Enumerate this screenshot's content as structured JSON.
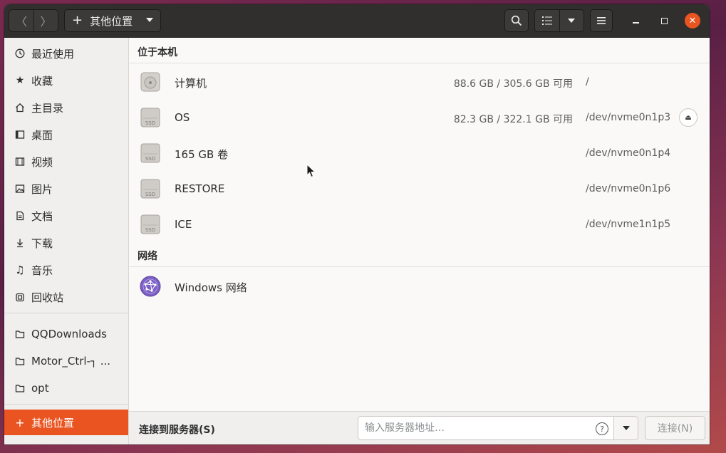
{
  "header": {
    "back_icon": "chevron-left-icon",
    "forward_icon": "chevron-right-icon",
    "location_label": "其他位置",
    "location_icon": "plus-icon"
  },
  "sidebar": {
    "items": [
      {
        "label": "最近使用",
        "icon": "clock-icon"
      },
      {
        "label": "收藏",
        "icon": "star-icon"
      },
      {
        "label": "主目录",
        "icon": "home-icon"
      },
      {
        "label": "桌面",
        "icon": "desktop-icon"
      },
      {
        "label": "视频",
        "icon": "film-icon"
      },
      {
        "label": "图片",
        "icon": "image-icon"
      },
      {
        "label": "文档",
        "icon": "document-icon"
      },
      {
        "label": "下载",
        "icon": "download-icon"
      },
      {
        "label": "音乐",
        "icon": "music-icon"
      },
      {
        "label": "回收站",
        "icon": "trash-icon"
      }
    ],
    "bookmarks": [
      {
        "label": "QQDownloads",
        "icon": "folder-icon"
      },
      {
        "label": "Motor_Ctrl-┐ ...",
        "icon": "folder-icon"
      },
      {
        "label": "opt",
        "icon": "folder-icon"
      }
    ],
    "other_locations": {
      "label": "其他位置",
      "icon": "plus-icon",
      "active_color": "#e95420"
    }
  },
  "main": {
    "local_section": "位于本机",
    "drives": [
      {
        "name": "计算机",
        "space": "88.6 GB / 305.6 GB 可用",
        "device": "/",
        "icon": "harddisk-icon"
      },
      {
        "name": "OS",
        "space": "82.3 GB / 322.1 GB 可用",
        "device": "/dev/nvme0n1p3",
        "icon": "ssd-icon",
        "ejectable": true
      },
      {
        "name": "165 GB 卷",
        "space": "",
        "device": "/dev/nvme0n1p4",
        "icon": "ssd-icon"
      },
      {
        "name": "RESTORE",
        "space": "",
        "device": "/dev/nvme0n1p6",
        "icon": "ssd-icon"
      },
      {
        "name": "ICE",
        "space": "",
        "device": "/dev/nvme1n1p5",
        "icon": "ssd-icon"
      }
    ],
    "network_section": "网络",
    "network": [
      {
        "name": "Windows 网络",
        "icon": "network-globe-icon"
      }
    ]
  },
  "bottom": {
    "connect_label": "连接到服务器(S)",
    "server_placeholder": "输入服务器地址…",
    "connect_button": "连接(N)"
  },
  "colors": {
    "accent": "#e95420",
    "headerbar": "#302f2d"
  }
}
